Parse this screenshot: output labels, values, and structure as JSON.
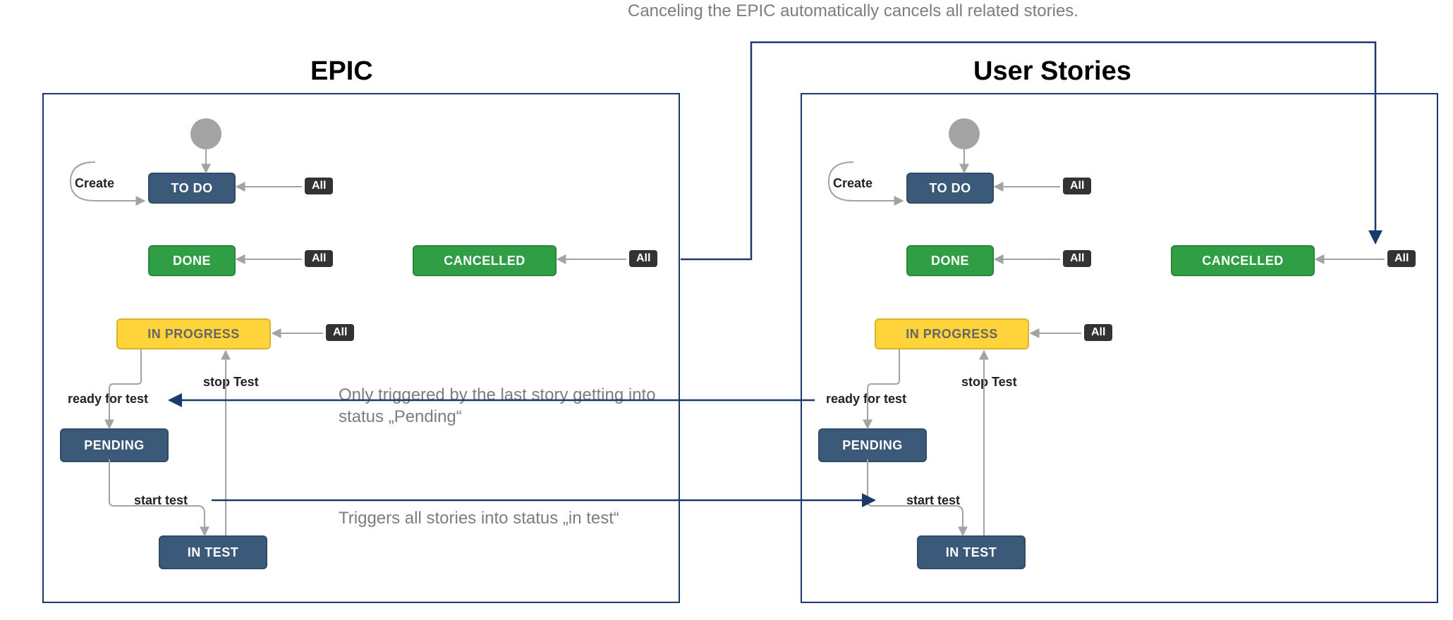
{
  "top_note": "Canceling the EPIC automatically cancels all related stories.",
  "panels": {
    "epic": {
      "title": "EPIC"
    },
    "stories": {
      "title": "User Stories"
    }
  },
  "states": {
    "todo": "TO DO",
    "done": "DONE",
    "cancelled": "CANCELLED",
    "in_progress": "IN PROGRESS",
    "pending": "PENDING",
    "in_test": "IN TEST"
  },
  "transitions": {
    "create": "Create",
    "ready_for_test": "ready for test",
    "stop_test": "stop Test",
    "start_test": "start test",
    "all": "All"
  },
  "notes": {
    "pending_trigger": "Only triggered by the last story getting into status „Pending“",
    "in_test_trigger": "Triggers all stories into status „in test“"
  }
}
